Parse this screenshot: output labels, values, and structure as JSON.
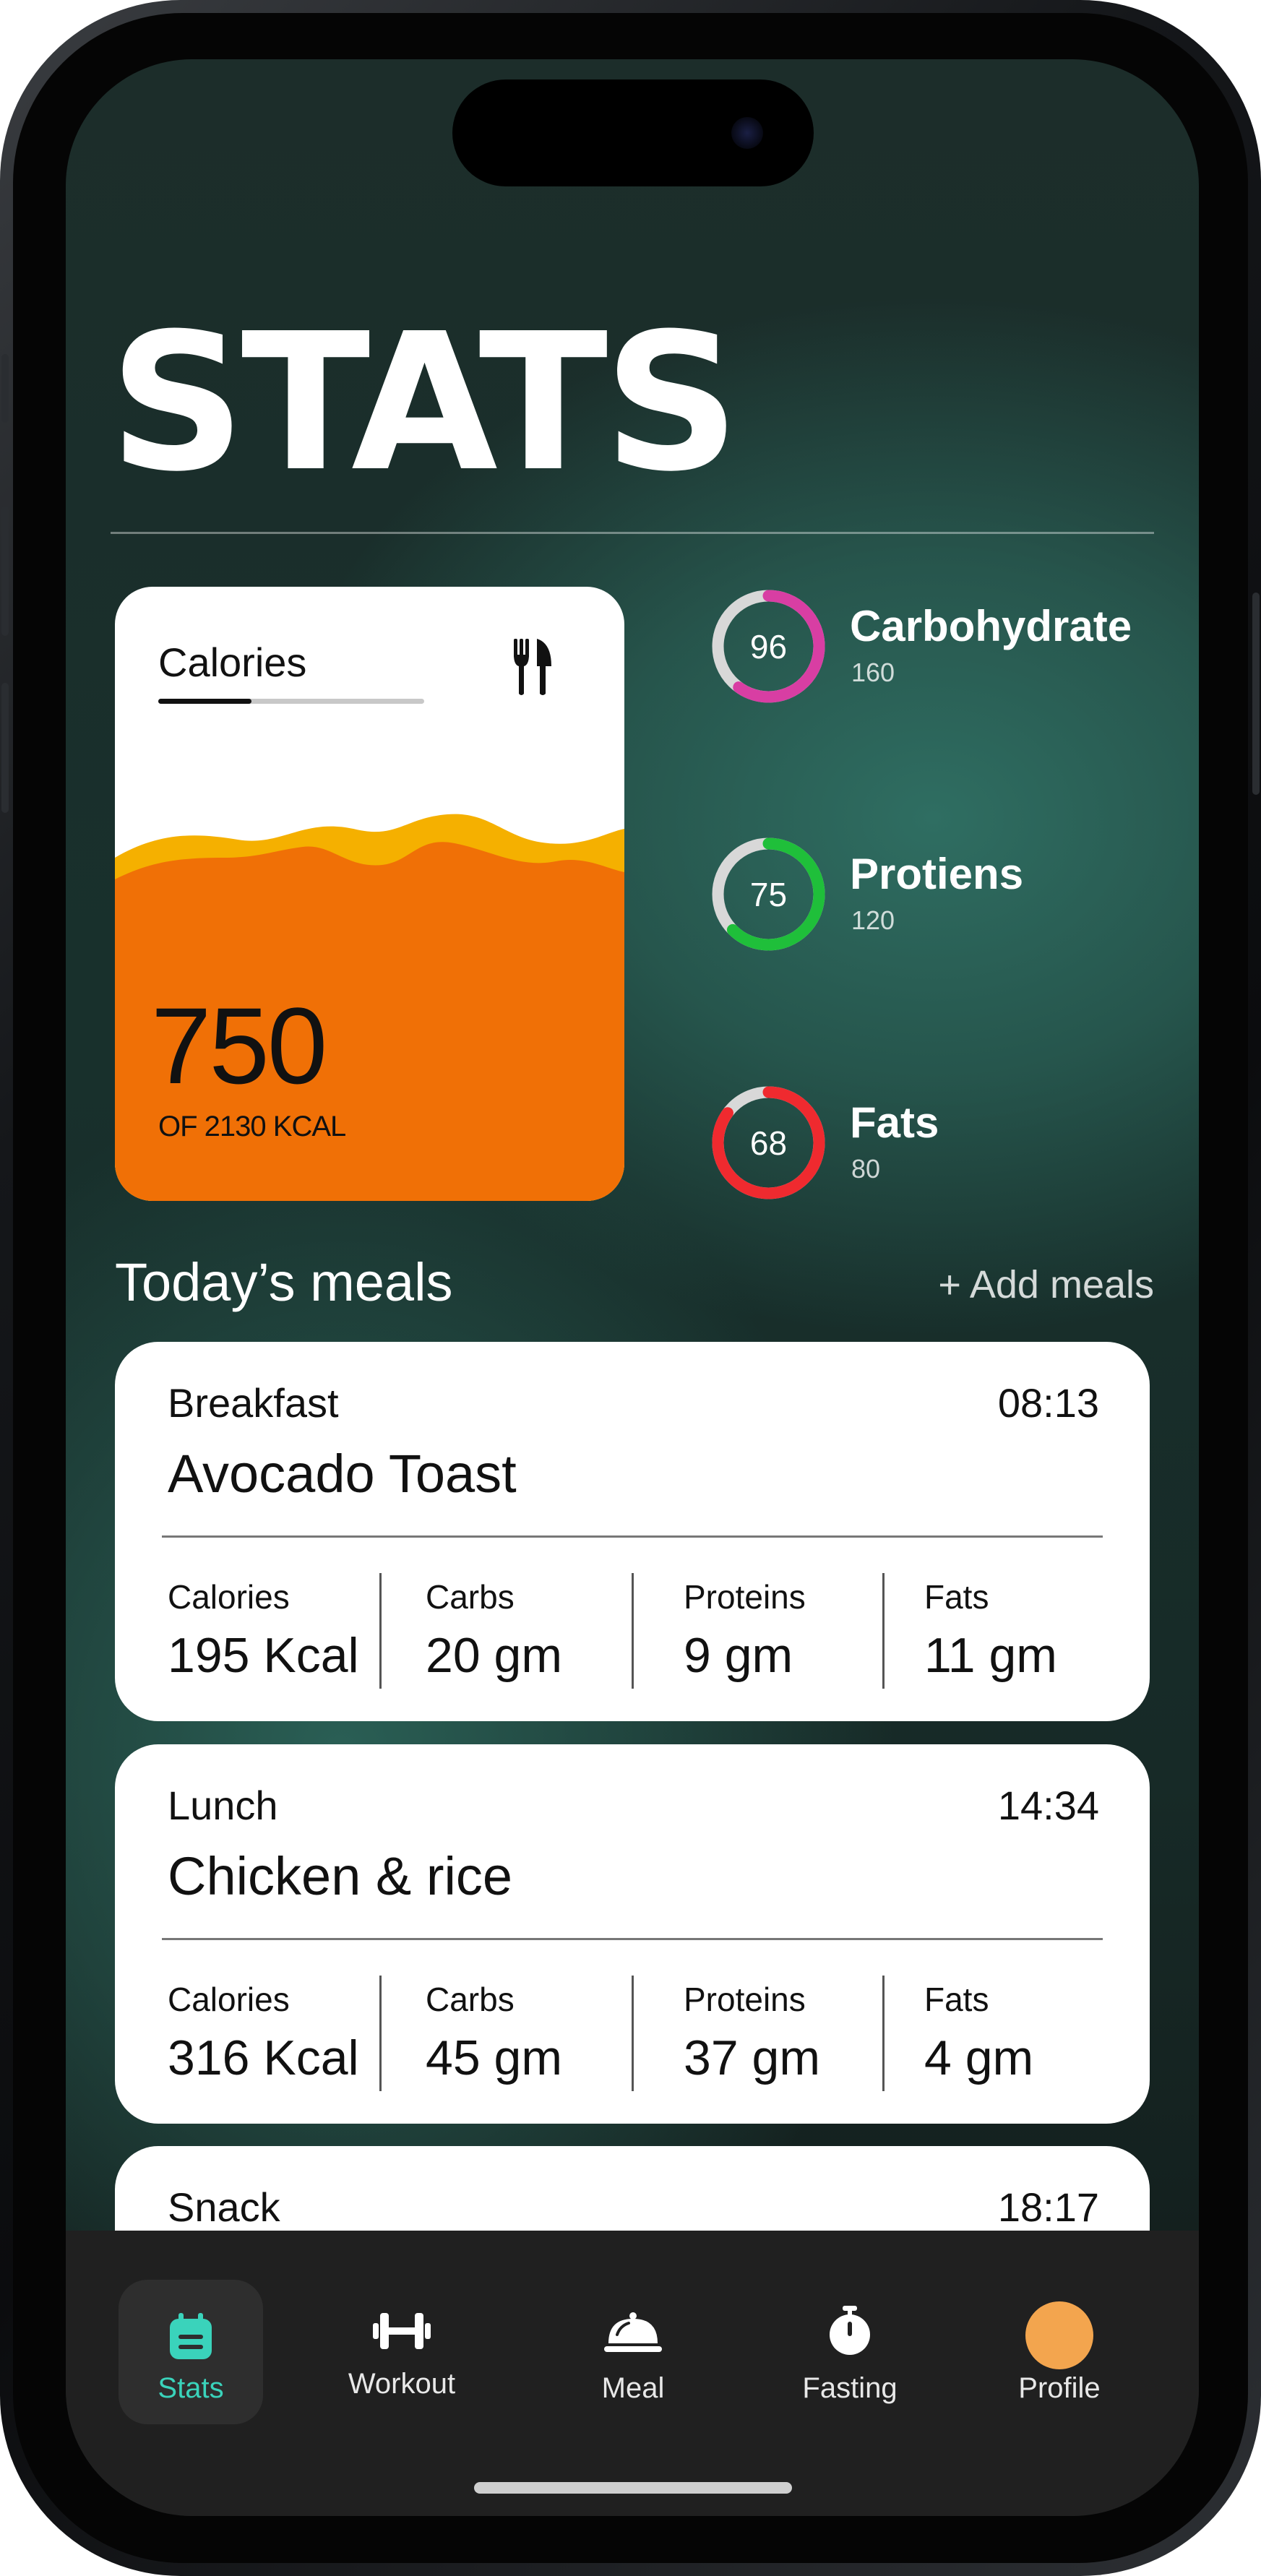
{
  "page": {
    "title": "STATS"
  },
  "calories": {
    "label": "Calories",
    "value": "750",
    "subtitle": "OF 2130 KCAL",
    "progress_fraction": 0.35
  },
  "macros": [
    {
      "name": "Carbohydrate",
      "ring_value": "96",
      "goal": "160",
      "fraction": 0.6,
      "color": "#d83ea3"
    },
    {
      "name": "Protiens",
      "ring_value": "75",
      "goal": "120",
      "fraction": 0.625,
      "color": "#1fbf3a"
    },
    {
      "name": "Fats",
      "ring_value": "68",
      "goal": "80",
      "fraction": 0.85,
      "color": "#ef2a2f"
    }
  ],
  "meals_section": {
    "title": "Today’s meals",
    "add_label": "+ Add meals"
  },
  "meals": [
    {
      "type": "Breakfast",
      "time": "08:13",
      "name": "Avocado Toast",
      "stats": [
        {
          "label": "Calories",
          "value": "195 Kcal"
        },
        {
          "label": "Carbs",
          "value": "20 gm"
        },
        {
          "label": "Proteins",
          "value": "9 gm"
        },
        {
          "label": "Fats",
          "value": "11 gm"
        }
      ]
    },
    {
      "type": "Lunch",
      "time": "14:34",
      "name": "Chicken & rice",
      "stats": [
        {
          "label": "Calories",
          "value": "316 Kcal"
        },
        {
          "label": "Carbs",
          "value": "45 gm"
        },
        {
          "label": "Proteins",
          "value": "37 gm"
        },
        {
          "label": "Fats",
          "value": "4 gm"
        }
      ]
    },
    {
      "type": "Snack",
      "time": "18:17"
    }
  ],
  "tabs": [
    {
      "label": "Stats",
      "icon": "calendar-icon",
      "active": true
    },
    {
      "label": "Workout",
      "icon": "dumbbell-icon",
      "active": false
    },
    {
      "label": "Meal",
      "icon": "cloche-icon",
      "active": false
    },
    {
      "label": "Fasting",
      "icon": "stopwatch-icon",
      "active": false
    },
    {
      "label": "Profile",
      "icon": "avatar-icon",
      "active": false
    }
  ],
  "colors": {
    "accent": "#3ad3bb",
    "calorie_liquid": "#f07006",
    "calorie_wave": "#f5b000",
    "avatar": "#f3a54e",
    "ring_track": "#d8d8d8"
  }
}
